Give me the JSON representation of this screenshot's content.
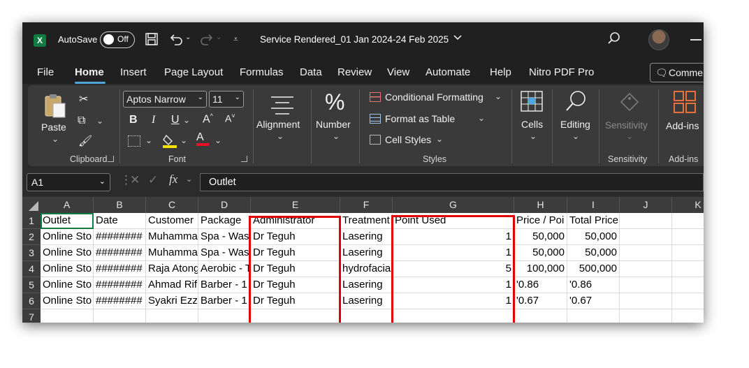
{
  "titlebar": {
    "app_icon": "excel-logo-icon",
    "autosave_label": "AutoSave",
    "autosave_state": "Off",
    "file_title": "Service Rendered_01 Jan 2024-24 Feb 2025"
  },
  "menu": {
    "tabs": [
      "File",
      "Home",
      "Insert",
      "Page Layout",
      "Formulas",
      "Data",
      "Review",
      "View",
      "Automate",
      "Help",
      "Nitro PDF Pro"
    ],
    "active": "Home",
    "comments_label": "Comme"
  },
  "ribbon": {
    "clipboard": {
      "paste_label": "Paste",
      "group_label": "Clipboard"
    },
    "font": {
      "family": "Aptos Narrow",
      "size": "11",
      "group_label": "Font"
    },
    "alignment": {
      "label": "Alignment"
    },
    "number": {
      "label": "Number"
    },
    "styles": {
      "conditional": "Conditional Formatting",
      "format_table": "Format as Table",
      "cell_styles": "Cell Styles",
      "group_label": "Styles"
    },
    "cells": {
      "label": "Cells"
    },
    "editing": {
      "label": "Editing"
    },
    "sensitivity": {
      "label": "Sensitivity",
      "group_label": "Sensitivity"
    },
    "addins": {
      "label": "Add-ins",
      "group_label": "Add-ins"
    }
  },
  "formula_bar": {
    "name_box": "A1",
    "formula": "Outlet"
  },
  "sheet": {
    "columns": [
      "A",
      "B",
      "C",
      "D",
      "E",
      "F",
      "G",
      "H",
      "I",
      "J",
      "K"
    ],
    "rows": [
      [
        "Outlet",
        "Date",
        "Customer",
        "Package",
        "Administrator",
        "Treatment",
        "Point Used",
        "Price / Poi",
        "Total Price",
        "",
        ""
      ],
      [
        "Online Sto",
        "########",
        "Muhamma",
        "Spa - Was",
        "Dr Teguh",
        "Lasering",
        "1",
        "50,000",
        "50,000",
        "",
        ""
      ],
      [
        "Online Sto",
        "########",
        "Muhamma",
        "Spa - Was",
        "Dr Teguh",
        "Lasering",
        "1",
        "50,000",
        "50,000",
        "",
        ""
      ],
      [
        "Online Sto",
        "########",
        "Raja Atong",
        "Aerobic - T",
        "Dr Teguh",
        "hydrofacia",
        "5",
        "100,000",
        "500,000",
        "",
        ""
      ],
      [
        "Online Sto",
        "########",
        "Ahmad Rif",
        "Barber - 1",
        "Dr Teguh",
        "Lasering",
        "1",
        "'0.86",
        "'0.86",
        "",
        ""
      ],
      [
        "Online Sto",
        "########",
        "Syakri Ezza",
        "Barber - 1",
        "Dr Teguh",
        "Lasering",
        "1",
        "'0.67",
        "'0.67",
        "",
        ""
      ],
      [
        "",
        "",
        "",
        "",
        "",
        "",
        "",
        "",
        "",
        "",
        ""
      ]
    ]
  },
  "highlight_color": "#e00000",
  "accent_color": "#107c41"
}
